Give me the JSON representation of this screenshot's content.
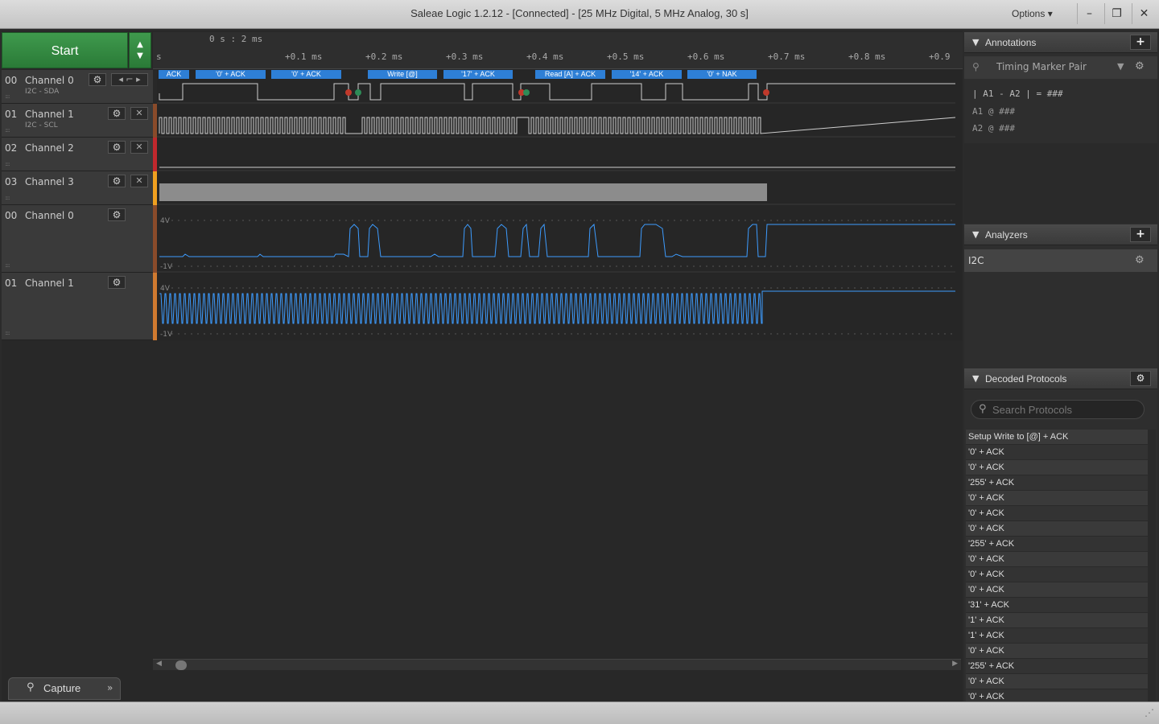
{
  "window": {
    "title": "Saleae Logic 1.2.12 - [Connected] - [25 MHz Digital, 5 MHz Analog, 30 s]",
    "options_label": "Options ▾"
  },
  "toolbar": {
    "start_label": "Start"
  },
  "ruler": {
    "origin": "0 s : 2 ms",
    "ticks": [
      "s",
      "+0.1 ms",
      "+0.2 ms",
      "+0.3 ms",
      "+0.4 ms",
      "+0.5 ms",
      "+0.6 ms",
      "+0.7 ms",
      "+0.8 ms",
      "+0.9"
    ]
  },
  "channels": [
    {
      "num": "00",
      "name": "Channel 0",
      "sub": "I2C - SDA",
      "color": "#8a4b2a"
    },
    {
      "num": "01",
      "name": "Channel 1",
      "sub": "I2C - SCL",
      "color": "#8a4b2a"
    },
    {
      "num": "02",
      "name": "Channel 2",
      "sub": "",
      "color": "#c0282d"
    },
    {
      "num": "03",
      "name": "Channel 3",
      "sub": "",
      "color": "#f0a020"
    },
    {
      "num": "00",
      "name": "Channel 0",
      "sub": "",
      "color": "#8a4b2a"
    },
    {
      "num": "01",
      "name": "Channel 1",
      "sub": "",
      "color": "#d07a30"
    }
  ],
  "protocol_labels": [
    "ACK",
    "'0' + ACK",
    "'0' + ACK",
    "Write [@]",
    "'17' + ACK",
    "Read [A] + ACK",
    "'14' + ACK",
    "'0' + NAK"
  ],
  "analog_scale": {
    "top": "4V",
    "bottom": "-1V"
  },
  "capture_tab": {
    "label": "Capture"
  },
  "annotations": {
    "title": "Annotations",
    "marker": "Timing Marker Pair",
    "line1": "| A1 - A2 | = ###",
    "line2": "A1  @  ###",
    "line3": "A2  @  ###"
  },
  "analyzers": {
    "title": "Analyzers",
    "items": [
      "I2C"
    ]
  },
  "decoded": {
    "title": "Decoded Protocols",
    "search_placeholder": "Search Protocols",
    "rows": [
      "Setup Write to [@] + ACK",
      "'0' + ACK",
      "'0' + ACK",
      "'255' + ACK",
      "'0' + ACK",
      "'0' + ACK",
      "'0' + ACK",
      "'255' + ACK",
      "'0' + ACK",
      "'0' + ACK",
      "'0' + ACK",
      "'31' + ACK",
      "'1' + ACK",
      "'1' + ACK",
      "'0' + ACK",
      "'255' + ACK",
      "'0' + ACK",
      "'0' + ACK"
    ]
  },
  "colors": {
    "accent": "#2e7fd6",
    "wave": "#3d9cff",
    "start": "#2f8a3e"
  }
}
